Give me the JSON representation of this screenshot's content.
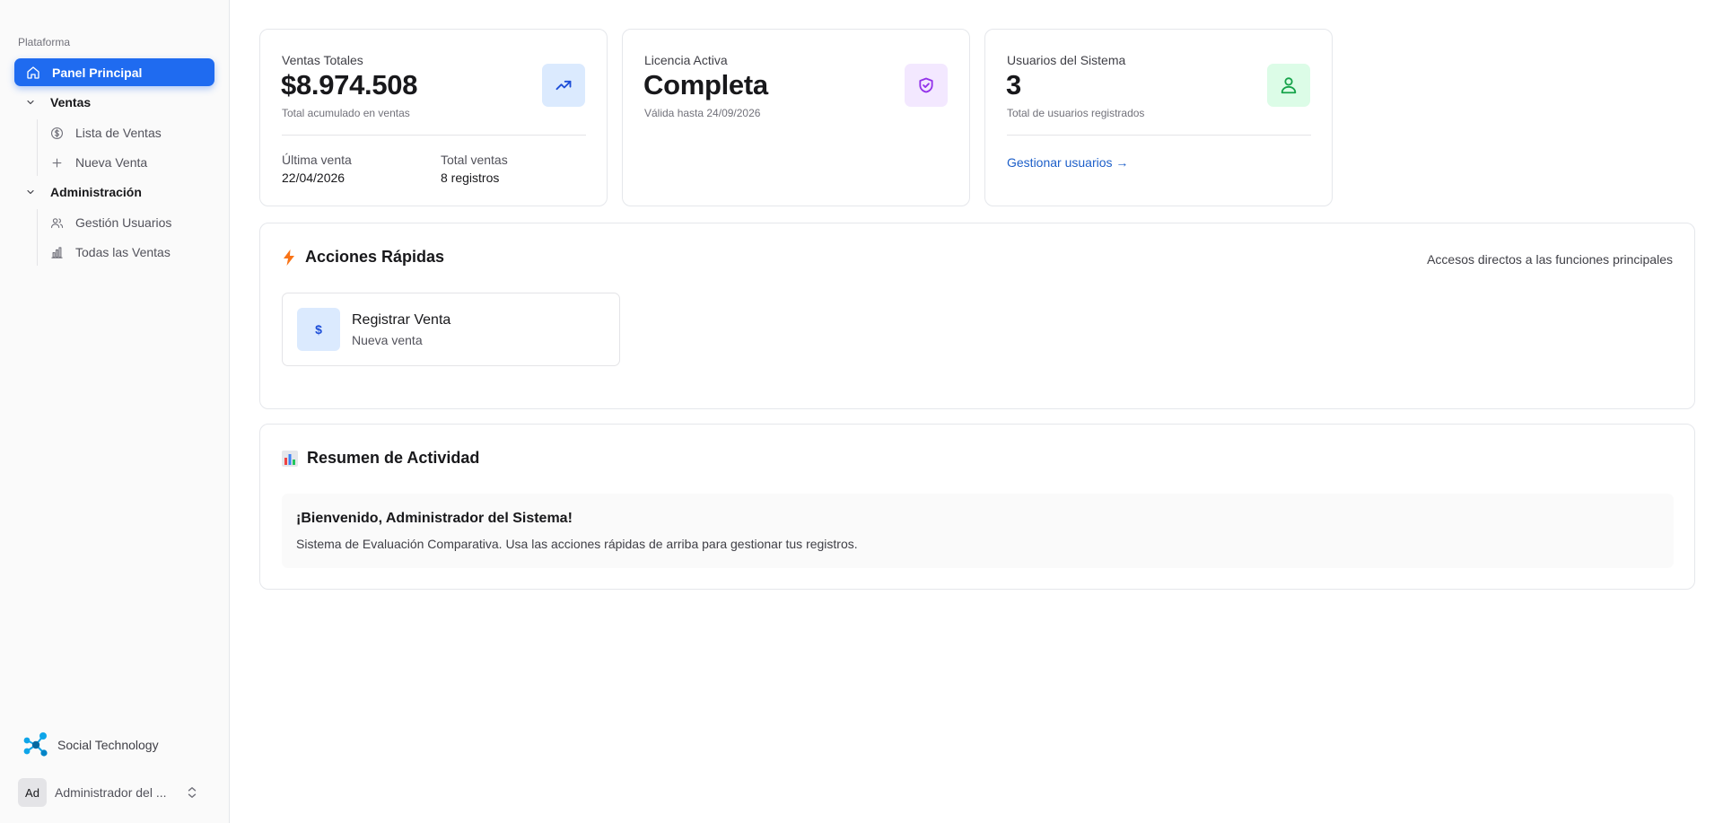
{
  "sidebar": {
    "group_label": "Plataforma",
    "active_item": {
      "label": "Panel Principal",
      "icon": "home-icon"
    },
    "sections": [
      {
        "label": "Ventas",
        "items": [
          {
            "label": "Lista de Ventas",
            "icon": "dollar-circle-icon"
          },
          {
            "label": "Nueva Venta",
            "icon": "plus-icon"
          }
        ]
      },
      {
        "label": "Administración",
        "items": [
          {
            "label": "Gestión Usuarios",
            "icon": "users-icon"
          },
          {
            "label": "Todas las Ventas",
            "icon": "bar-chart-icon"
          }
        ]
      }
    ],
    "brand": {
      "name": "Social Technology",
      "icon": "molecule-logo-icon"
    },
    "user": {
      "initials": "Ad",
      "name": "Administrador del ..."
    }
  },
  "stats": {
    "sales": {
      "label": "Ventas Totales",
      "value": "$8.974.508",
      "sub": "Total acumulado en ventas",
      "last_sale_label": "Última venta",
      "last_sale_value": "22/04/2026",
      "total_label": "Total ventas",
      "total_value": "8 registros",
      "icon": "trending-up-icon"
    },
    "license": {
      "label": "Licencia Activa",
      "value": "Completa",
      "sub": "Válida hasta 24/09/2026",
      "icon": "shield-check-icon"
    },
    "users": {
      "label": "Usuarios del Sistema",
      "value": "3",
      "sub": "Total de usuarios registrados",
      "link": "Gestionar usuarios →",
      "icon": "users-icon"
    }
  },
  "quick_actions": {
    "title": "Acciones Rápidas",
    "note": "Accesos directos a las funciones principales",
    "icon": "lightning-icon",
    "actions": [
      {
        "title": "Registrar Venta",
        "sub": "Nueva venta",
        "icon_text": "$"
      }
    ]
  },
  "activity": {
    "title": "Resumen de Actividad",
    "icon": "bar-chart-emoji-icon",
    "welcome_title": "¡Bienvenido, Administrador del Sistema!",
    "welcome_text": "Sistema de Evaluación Comparativa. Usa las acciones rápidas de arriba para gestionar tus registros."
  },
  "colors": {
    "accent": "#1f6bf0",
    "blue_tint": "#dbeafe",
    "purple_tint": "#f3e8ff",
    "green_tint": "#dcfce7"
  }
}
